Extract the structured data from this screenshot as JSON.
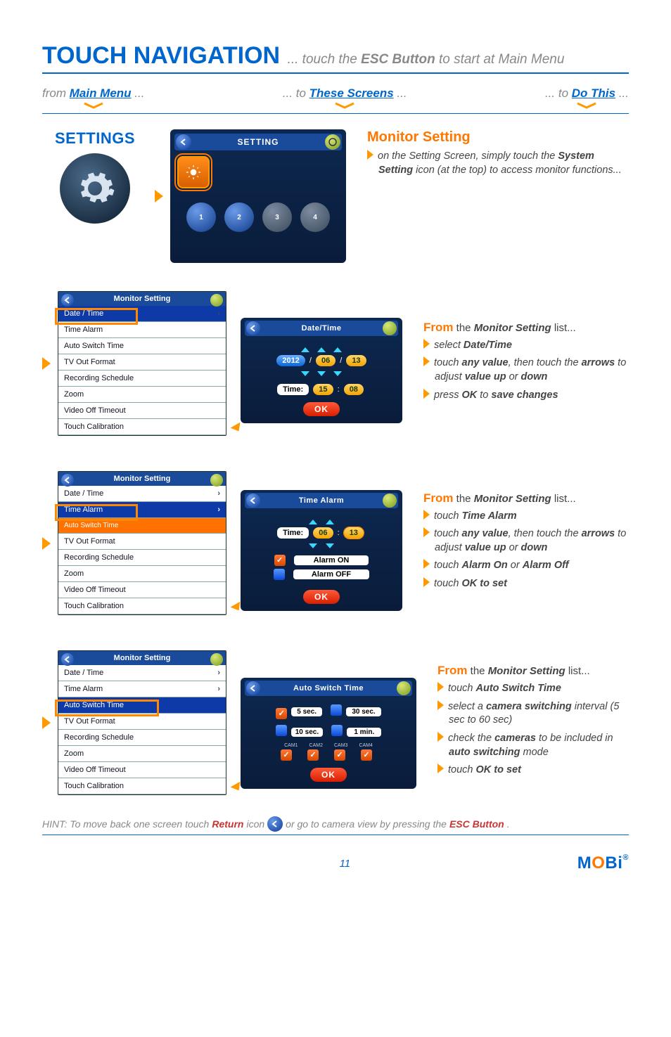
{
  "title": "TOUCH NAVIGATION",
  "subtitle_pre": "... touch the ",
  "subtitle_em": "ESC Button",
  "subtitle_post": " to start at Main Menu",
  "nav": {
    "from_pre": "from ",
    "from_em": "Main Menu",
    "from_post": " ...",
    "to1_pre": "... to ",
    "to1_em": "These Screens",
    "to1_post": " ...",
    "to2_pre": "... to ",
    "to2_em": "Do This",
    "to2_post": " ..."
  },
  "settings_label": "SETTINGS",
  "setting_panel_title": "SETTING",
  "cam_icons": [
    "1",
    "2",
    "3",
    "4"
  ],
  "monitor_setting": {
    "title": "Monitor Setting",
    "intro_pre": "on the Setting Screen, simply touch the ",
    "intro_b": "System Setting",
    "intro_post": " icon (at the top) to access monitor functions..."
  },
  "list_title": "Monitor Setting",
  "list_items": [
    "Date / Time",
    "Time Alarm",
    "Auto Switch Time",
    "TV Out Format",
    "Recording Schedule",
    "Zoom",
    "Video Off Timeout",
    "Touch Calibration"
  ],
  "section1": {
    "from_label": "From",
    "from_rest": " the ",
    "from_em": "Monitor Setting",
    "from_tail": " list...",
    "b1_pre": "select ",
    "b1_b": "Date/Time",
    "b2_pre": "touch ",
    "b2_b1": "any value",
    "b2_mid": ", then touch the ",
    "b2_b2": "arrows",
    "b2_post1": " to adjust ",
    "b2_b3": "value up",
    "b2_post2": " or ",
    "b2_b4": "down",
    "b3_pre": "press ",
    "b3_b1": "OK",
    "b3_mid": " to ",
    "b3_b2": "save changes"
  },
  "date_panel": {
    "title": "Date/Time",
    "year": "2012",
    "month": "06",
    "day": "13",
    "time_label": "Time:",
    "hh": "15",
    "mm": "08",
    "ok": "OK"
  },
  "section2": {
    "from_label": "From",
    "from_rest": " the ",
    "from_em": "Monitor Setting",
    "from_tail": " list...",
    "b1_pre": "touch ",
    "b1_b": "Time Alarm",
    "b2_pre": "touch ",
    "b2_b1": "any value",
    "b2_mid": ", then touch the ",
    "b2_b2": "arrows",
    "b2_post1": " to adjust ",
    "b2_b3": "value up",
    "b2_post2": " or ",
    "b2_b4": "down",
    "b3_pre": "touch ",
    "b3_b1": "Alarm On",
    "b3_mid": " or ",
    "b3_b2": "Alarm Off",
    "b4_pre": "touch ",
    "b4_b": "OK to set"
  },
  "alarm_panel": {
    "title": "Time Alarm",
    "time_label": "Time:",
    "hh": "06",
    "mm": "13",
    "on": "Alarm ON",
    "off": "Alarm OFF",
    "ok": "OK"
  },
  "section3": {
    "from_label": "From",
    "from_rest": " the ",
    "from_em": "Monitor Setting",
    "from_tail": " list...",
    "b1_pre": "touch ",
    "b1_b": "Auto Switch Time",
    "b2_pre": "select a ",
    "b2_b": "camera switching",
    "b2_post": " interval (5 sec to 60 sec)",
    "b3_pre": "check the ",
    "b3_b1": "cameras",
    "b3_mid": " to be included in ",
    "b3_b2": "auto switching",
    "b3_post": " mode",
    "b4_pre": "touch ",
    "b4_b": "OK to set"
  },
  "switch_panel": {
    "title": "Auto Switch Time",
    "opt1": "5 sec.",
    "opt2": "30 sec.",
    "opt3": "10 sec.",
    "opt4": "1 min.",
    "cams": [
      "CAM1",
      "CAM2",
      "CAM3",
      "CAM4"
    ],
    "ok": "OK"
  },
  "hint": {
    "pre": "HINT: To move back one screen touch ",
    "b1": "Return",
    "mid1": " icon ",
    "mid2": " or go to camera view by pressing the ",
    "b2": "ESC Button",
    "post": "."
  },
  "page_number": "11",
  "brand": {
    "m": "M",
    "o": "O",
    "rest": "Bi",
    "reg": "®"
  }
}
